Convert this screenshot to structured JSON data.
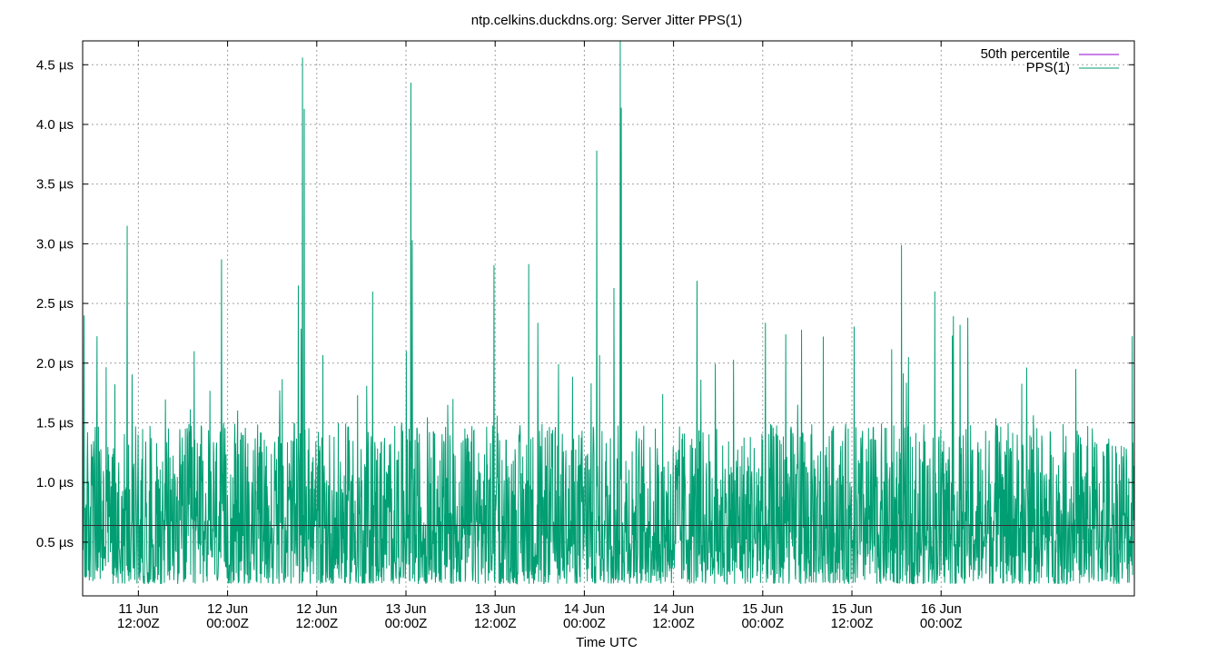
{
  "chart_data": {
    "type": "line",
    "title": "ntp.celkins.duckdns.org: Server Jitter PPS(1)",
    "xlabel": "Time UTC",
    "ylabel": "",
    "y_unit": "µs",
    "ylim": [
      0.05,
      4.7
    ],
    "xlim": [
      "2023-06-10 04:30Z",
      "2023-06-16 02:00Z"
    ],
    "grid": true,
    "legend_position": "top-right",
    "y_ticks": [
      {
        "value": 0.5,
        "label": "0.5 µs"
      },
      {
        "value": 1.0,
        "label": "1.0 µs"
      },
      {
        "value": 1.5,
        "label": "1.5 µs"
      },
      {
        "value": 2.0,
        "label": "2.0 µs"
      },
      {
        "value": 2.5,
        "label": "2.5 µs"
      },
      {
        "value": 3.0,
        "label": "3.0 µs"
      },
      {
        "value": 3.5,
        "label": "3.5 µs"
      },
      {
        "value": 4.0,
        "label": "4.0 µs"
      },
      {
        "value": 4.5,
        "label": "4.5 µs"
      }
    ],
    "x_ticks": [
      {
        "time": "2023-06-10 12:00Z",
        "line1": "11 Jun",
        "line2": "12:00Z"
      },
      {
        "time": "2023-06-11 00:00Z",
        "line1": "12 Jun",
        "line2": "00:00Z"
      },
      {
        "time": "2023-06-11 12:00Z",
        "line1": "12 Jun",
        "line2": "12:00Z"
      },
      {
        "time": "2023-06-12 00:00Z",
        "line1": "13 Jun",
        "line2": "00:00Z"
      },
      {
        "time": "2023-06-12 12:00Z",
        "line1": "13 Jun",
        "line2": "12:00Z"
      },
      {
        "time": "2023-06-13 00:00Z",
        "line1": "14 Jun",
        "line2": "00:00Z"
      },
      {
        "time": "2023-06-13 12:00Z",
        "line1": "14 Jun",
        "line2": "12:00Z"
      },
      {
        "time": "2023-06-14 00:00Z",
        "line1": "15 Jun",
        "line2": "00:00Z"
      },
      {
        "time": "2023-06-14 12:00Z",
        "line1": "15 Jun",
        "line2": "12:00Z"
      },
      {
        "time": "2023-06-15 00:00Z",
        "line1": "16 Jun",
        "line2": "00:00Z"
      }
    ],
    "series": [
      {
        "name": "50th percentile",
        "color": "#9400d3",
        "plot_color": "#333333",
        "kind": "reference_line",
        "value": 0.64
      },
      {
        "name": "PPS(1)",
        "color": "#009e73",
        "kind": "line",
        "typical_range": [
          0.15,
          1.5
        ],
        "peaks": [
          {
            "time": "2023-06-10 04:40Z",
            "value": 2.4
          },
          {
            "time": "2023-06-10 10:30Z",
            "value": 3.15
          },
          {
            "time": "2023-06-10 19:30Z",
            "value": 2.1
          },
          {
            "time": "2023-06-10 23:10Z",
            "value": 2.87
          },
          {
            "time": "2023-06-11 09:30Z",
            "value": 2.65
          },
          {
            "time": "2023-06-11 10:05Z",
            "value": 4.56
          },
          {
            "time": "2023-06-11 10:20Z",
            "value": 4.13
          },
          {
            "time": "2023-06-11 19:30Z",
            "value": 2.6
          },
          {
            "time": "2023-06-12 00:40Z",
            "value": 4.35
          },
          {
            "time": "2023-06-12 00:50Z",
            "value": 3.03
          },
          {
            "time": "2023-06-12 11:50Z",
            "value": 2.82
          },
          {
            "time": "2023-06-12 16:30Z",
            "value": 2.83
          },
          {
            "time": "2023-06-13 01:40Z",
            "value": 3.78
          },
          {
            "time": "2023-06-13 04:00Z",
            "value": 2.63
          },
          {
            "time": "2023-06-13 04:50Z",
            "value": 4.7
          },
          {
            "time": "2023-06-13 04:58Z",
            "value": 4.14
          },
          {
            "time": "2023-06-13 15:10Z",
            "value": 2.69
          },
          {
            "time": "2023-06-14 18:40Z",
            "value": 2.99
          },
          {
            "time": "2023-06-14 23:10Z",
            "value": 2.6
          },
          {
            "time": "2023-06-15 01:30Z",
            "value": 2.23
          }
        ]
      }
    ]
  }
}
